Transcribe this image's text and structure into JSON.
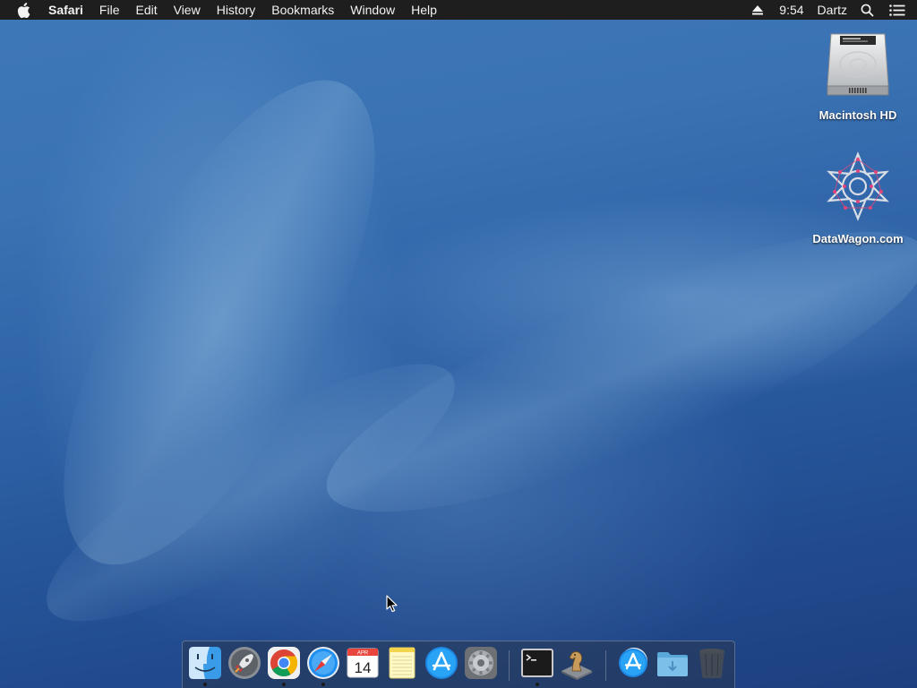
{
  "menubar": {
    "app_name": "Safari",
    "items": [
      "File",
      "Edit",
      "View",
      "History",
      "Bookmarks",
      "Window",
      "Help"
    ],
    "clock": "9:54",
    "user": "Dartz"
  },
  "desktop": {
    "icons": [
      {
        "label": "Macintosh HD",
        "icon": "hard-drive-icon"
      },
      {
        "label": "DataWagon.com",
        "icon": "datawagon-logo-icon"
      }
    ]
  },
  "dock": {
    "apps": [
      {
        "name": "finder",
        "running": true
      },
      {
        "name": "launchpad",
        "running": false
      },
      {
        "name": "chrome",
        "running": true
      },
      {
        "name": "safari",
        "running": true
      },
      {
        "name": "calendar",
        "running": false,
        "month": "APR",
        "day": "14"
      },
      {
        "name": "notes",
        "running": false
      },
      {
        "name": "app-store",
        "running": false
      },
      {
        "name": "system-preferences",
        "running": false
      },
      {
        "name": "terminal",
        "running": true
      },
      {
        "name": "chess",
        "running": false
      },
      {
        "name": "app-store-downloads",
        "running": false
      },
      {
        "name": "downloads-folder",
        "running": false
      },
      {
        "name": "trash",
        "running": false
      }
    ]
  },
  "colors": {
    "menubar_bg": "#1e1e1e",
    "desktop_top": "#3f78b8",
    "desktop_bottom": "#1d3f80"
  }
}
